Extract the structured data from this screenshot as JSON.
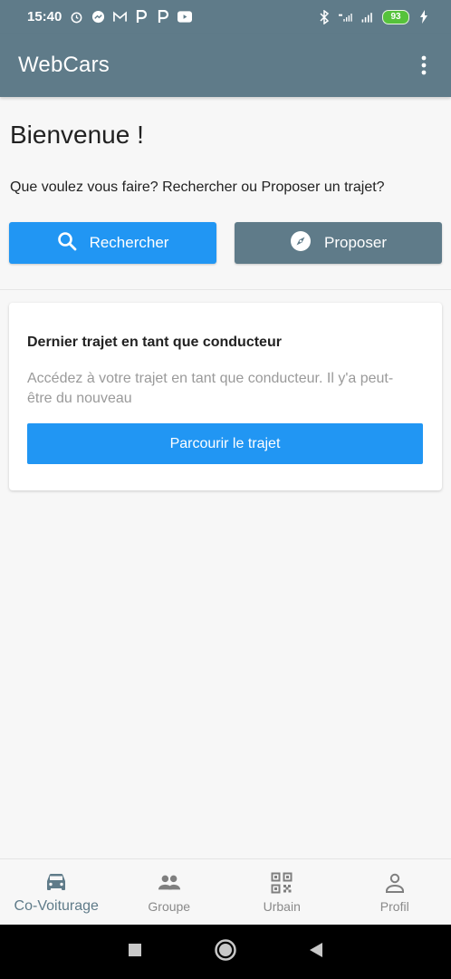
{
  "status_bar": {
    "time": "15:40",
    "battery": "93"
  },
  "app_bar": {
    "title": "WebCars",
    "menu_icon": "more-vert-icon"
  },
  "main": {
    "welcome": "Bienvenue !",
    "question": "Que voulez vous faire? Rechercher ou Proposer un trajet?",
    "search_button": "Rechercher",
    "propose_button": "Proposer"
  },
  "card": {
    "title": "Dernier trajet en tant que conducteur",
    "description": "Accédez à votre trajet en tant que  conducteur. Il y'a peut-être du nouveau",
    "button": "Parcourir le trajet"
  },
  "bottom_nav": {
    "items": [
      {
        "label": "Co-Voiturage",
        "icon": "car-icon",
        "active": true
      },
      {
        "label": "Groupe",
        "icon": "group-icon",
        "active": false
      },
      {
        "label": "Urbain",
        "icon": "qr-code-icon",
        "active": false
      },
      {
        "label": "Profil",
        "icon": "person-icon",
        "active": false
      }
    ]
  },
  "colors": {
    "primary": "#5f7b89",
    "accent": "#2196f3",
    "background": "#f7f7f7"
  }
}
